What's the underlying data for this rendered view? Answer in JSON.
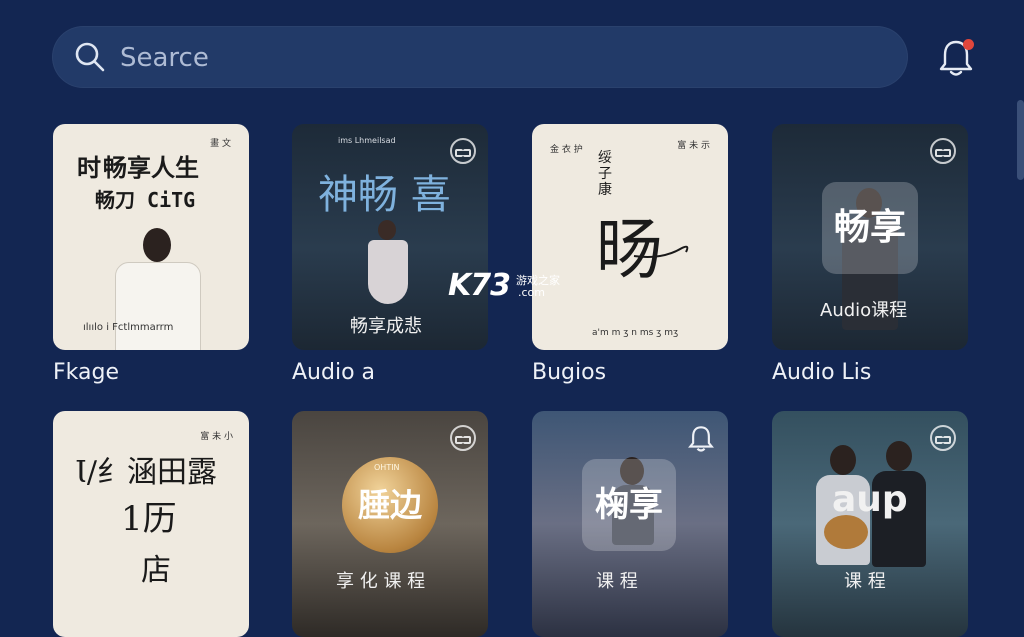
{
  "search": {
    "placeholder": "Searce"
  },
  "watermark": {
    "logo": "K73",
    "site": "游戏之家",
    "domain": ".com"
  },
  "row1": [
    {
      "caption": "Fkage",
      "title_line1": "畅享人生",
      "title_prefix": "时",
      "title_line2": "畅刀 CiTG",
      "corner_text": "畫 文",
      "footer_text": "ılıılo i Fctlmmarrm"
    },
    {
      "caption": "Audio a",
      "header_text": "ims Lhmeilsad",
      "title": "神畅 喜",
      "subtitle": "畅享成悲"
    },
    {
      "caption": "Bugios",
      "corner_left": "金 衣 护",
      "corner_right": "富 未 示",
      "title_small": "绥 子 康",
      "title_big": "旸",
      "footer_text": "a'm m ʒ n ms ʒ mʒ"
    },
    {
      "caption": "Audio Lis",
      "badge": "畅享",
      "subtitle": "Audio课程"
    }
  ],
  "row2": [
    {
      "caption": "",
      "corner_text": "富 未 小",
      "title_line1": "Ɩ/纟涵田露",
      "title_line2": "1历",
      "title_line3": "店"
    },
    {
      "caption": "",
      "badge": "腄边",
      "disc_small": "OHTIN",
      "subtitle": "享 化 课 程"
    },
    {
      "caption": "",
      "badge": "椈享",
      "subtitle": "课 程"
    },
    {
      "caption": "",
      "badge": "aup",
      "subtitle": "课 程"
    }
  ],
  "colors": {
    "background": "#132652",
    "search_bg": "#223a68",
    "notification_dot": "#e0463c"
  },
  "icons": [
    "search-icon",
    "bell-icon",
    "more-icon",
    "bell-icon"
  ]
}
